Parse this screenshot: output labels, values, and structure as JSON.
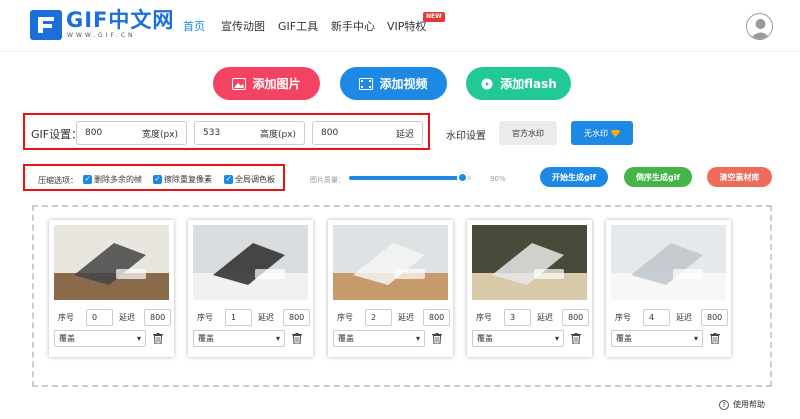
{
  "logo": {
    "text": "GIF中文网",
    "sub": "WWW.GIF.CN"
  },
  "nav": [
    {
      "label": "首页"
    },
    {
      "label": "宣传动图"
    },
    {
      "label": "GIF工具"
    },
    {
      "label": "新手中心"
    },
    {
      "label": "VIP特权"
    }
  ],
  "nav_badge": "NEW",
  "actions": {
    "add_image": "添加图片",
    "add_video": "添加视频",
    "add_flash": "添加flash"
  },
  "gif_settings": {
    "label": "GIF设置：",
    "width_value": "800",
    "width_unit": "宽度(px)",
    "height_value": "533",
    "height_unit": "高度(px)",
    "delay_value": "800",
    "delay_unit": "延迟"
  },
  "watermark": {
    "label": "水印设置",
    "official": "官方水印",
    "none": "无水印"
  },
  "compress": {
    "label": "压缩选项：",
    "opt1": "删除多余的帧",
    "opt2": "擦除重复像素",
    "opt3": "全局调色板"
  },
  "quality": {
    "label": "图片质量：",
    "value": "90%",
    "fraction": 0.9
  },
  "pills": {
    "start": "开始生成gif",
    "invert": "倒序生成gif",
    "clear": "清空素材库"
  },
  "frame_labels": {
    "seq": "序号",
    "delay": "延迟",
    "select": "覆盖"
  },
  "frames": [
    {
      "seq": "0",
      "delay": "800"
    },
    {
      "seq": "1",
      "delay": "800"
    },
    {
      "seq": "2",
      "delay": "800"
    },
    {
      "seq": "3",
      "delay": "800"
    },
    {
      "seq": "4",
      "delay": "800"
    }
  ],
  "help": "使用帮助",
  "colors": {
    "blue": "#1e88e5",
    "red": "#f24462",
    "green": "#20c997",
    "pill_green": "#44b549",
    "pill_red": "#ee6a5a"
  }
}
